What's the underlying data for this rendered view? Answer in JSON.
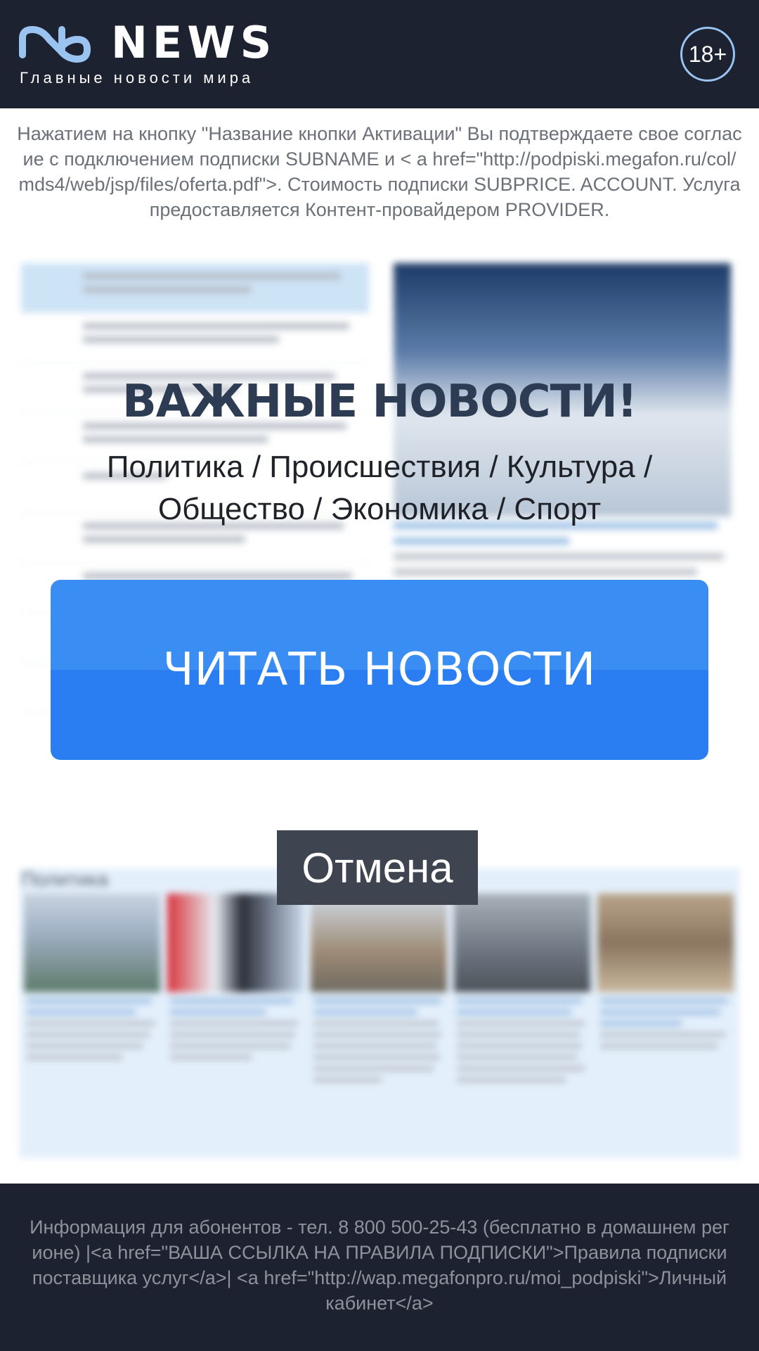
{
  "header": {
    "brand": "NEWS",
    "tagline": "Главные новости мира",
    "age_rating": "18+",
    "logo_icon": "ns-logo-icon",
    "colors": {
      "background": "#1c2230",
      "logo": "#9bc3ef"
    }
  },
  "consent_text": "Нажатием на кнопку \"Название кнопки Активации\" Вы подтверждаете свое согласие с подключением подписки SUBNAME и < a href=\"http://podpiski.megafon.ru/col/mds4/web/jsp/files/oferta.pdf\">. Стоимость подписки SUBPRICE. ACCOUNT. Услуга предоставляется Контент-провайдером PROVIDER.",
  "promo": {
    "headline": "ВАЖНЫЕ НОВОСТИ!",
    "categories": "Политика / Происшествия / Культура / Общество  / Экономика / Спорт",
    "cta_label": "ЧИТАТЬ НОВОСТИ",
    "cancel_label": "Отмена",
    "colors": {
      "cta": "#2b7ef2",
      "cancel": "#3e4450",
      "headline": "#2d3c52"
    }
  },
  "background": {
    "section_title": "Политика"
  },
  "footer_text": "Информация для абонентов - тел. 8 800 500-25-43 (бесплатно в домашнем регионе) |<a href=\"ВАША ССЫЛКА НА ПРАВИЛА ПОДПИСКИ\">Правила подписки поставщика услуг</a>| <a href=\"http://wap.megafonpro.ru/moi_podpiski\">Личный кабинет</a>"
}
